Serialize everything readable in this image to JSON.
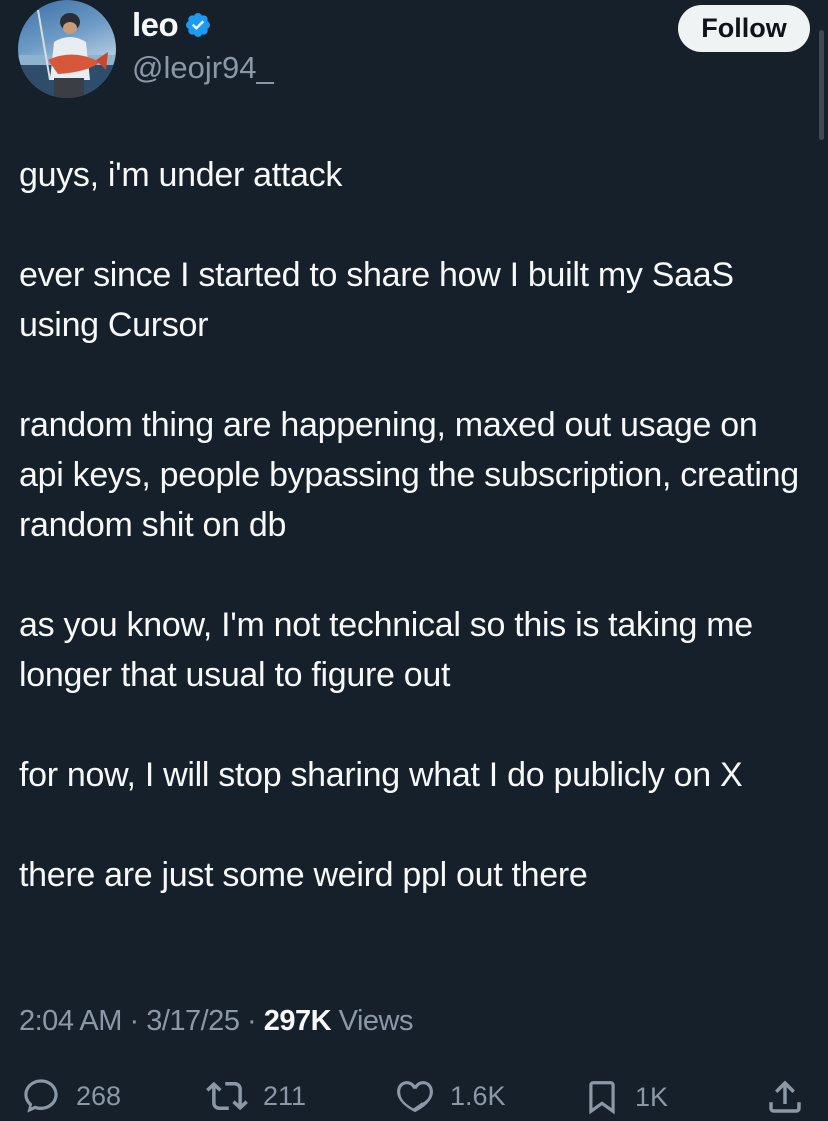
{
  "author": {
    "display_name": "leo",
    "handle": "@leojr94_",
    "verified": true,
    "avatar_icon": "avatar-fisherman-photo"
  },
  "follow_button": {
    "label": "Follow"
  },
  "tweet": {
    "paragraphs": [
      "guys, i'm under attack",
      "ever since I started to share how I built my SaaS using Cursor",
      "random thing are happening, maxed out usage on api keys, people bypassing the subscription, creating random shit on db",
      "as you know, I'm not technical so this is taking me longer that usual to figure out",
      "for now, I will stop sharing what I do publicly on X",
      "there are just some weird ppl out there"
    ]
  },
  "meta": {
    "time": "2:04 AM",
    "separator": " · ",
    "date": "3/17/25",
    "views_count": "297K",
    "views_label": " Views"
  },
  "actions": {
    "replies": {
      "icon": "reply-icon",
      "count": "268"
    },
    "retweets": {
      "icon": "retweet-icon",
      "count": "211"
    },
    "likes": {
      "icon": "heart-icon",
      "count": "1.6K"
    },
    "bookmarks": {
      "icon": "bookmark-icon",
      "count": "1K"
    },
    "share": {
      "icon": "share-icon"
    }
  },
  "colors": {
    "background": "#15202b",
    "text": "#f7f9f9",
    "secondary_text": "#8b98a5",
    "verified_badge": "#1d9bf0",
    "follow_button_bg": "#eff3f4"
  }
}
